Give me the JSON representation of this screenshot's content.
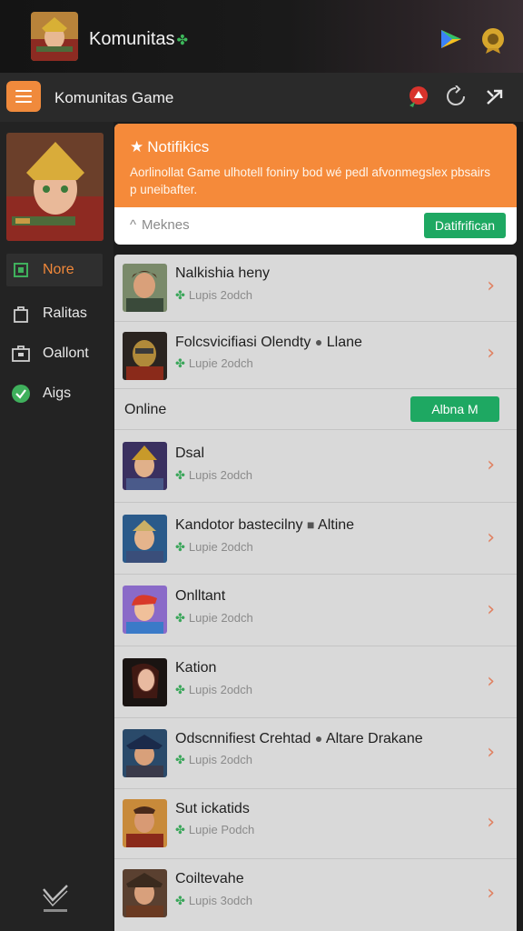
{
  "app": {
    "title": "Komunitas"
  },
  "toolbar": {
    "title": "Komunitas Game"
  },
  "sidebar": {
    "items": [
      {
        "label": "Nore",
        "active": true
      },
      {
        "label": "Ralitas"
      },
      {
        "label": "Oallont"
      },
      {
        "label": "Aigs"
      }
    ]
  },
  "notification": {
    "title": "Notifikics",
    "body": "Aorlinollat Game ulhotell foniny bod wé pedl afvonmegslex pbsairs p uneibafter.",
    "more_label": "Meknes",
    "button_label": "Datifrifican"
  },
  "online_section": {
    "label": "Online",
    "button_label": "Albna M"
  },
  "friends": [
    {
      "name": "Nalkishia heny",
      "status": "Lupis 2odch"
    },
    {
      "name": "Folcsvicifiasi Olendty",
      "tag": "Llane",
      "status": "Lupie 2odch"
    },
    {
      "name": "Dsal",
      "status": "Lupis 2odch"
    },
    {
      "name": "Kandotor bastecilny",
      "tag": "Altine",
      "status": "Lupie 2odch"
    },
    {
      "name": "Onlltant",
      "status": "Lupie 2odch"
    },
    {
      "name": "Kation",
      "status": "Lupis 2odch"
    },
    {
      "name": "Odscnnifiest Crehtad",
      "tag": "Altare Drakane",
      "status": "Lupis 2odch"
    },
    {
      "name": "Sut ickatids",
      "status": "Lupie Podch"
    },
    {
      "name": "Coiltevahe",
      "status": "Lupis 3odch"
    }
  ],
  "colors": {
    "accent": "#f58a3a",
    "button_green": "#1ea862",
    "status_green": "#3aa65a"
  }
}
